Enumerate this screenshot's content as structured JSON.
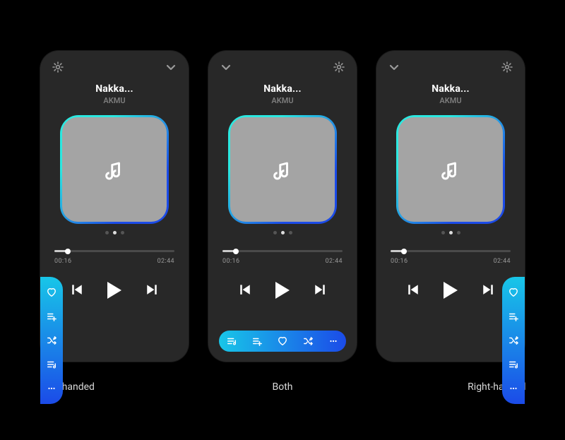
{
  "track": {
    "title": "Nakka...",
    "artist": "AKMU"
  },
  "time": {
    "elapsed": "00:16",
    "total": "02:44",
    "progress_pct": 11
  },
  "pager": {
    "count": 3,
    "active": 1
  },
  "labels": {
    "left": "Left-handed",
    "both": "Both",
    "right": "Right-handed"
  },
  "icons": {
    "gear": "settings",
    "chevron": "collapse",
    "prev": "previous-track",
    "play": "play",
    "next": "next-track",
    "heart": "favorite",
    "add_queue": "add-to-queue",
    "shuffle": "shuffle",
    "queue": "queue",
    "more": "more",
    "music": "album-art"
  },
  "rail": {
    "left_items": [
      "heart",
      "add_queue",
      "shuffle",
      "queue",
      "more"
    ],
    "right_items": [
      "heart",
      "add_queue",
      "shuffle",
      "queue",
      "more"
    ],
    "bottom_items": [
      "queue",
      "add_queue",
      "heart",
      "shuffle",
      "more"
    ]
  }
}
